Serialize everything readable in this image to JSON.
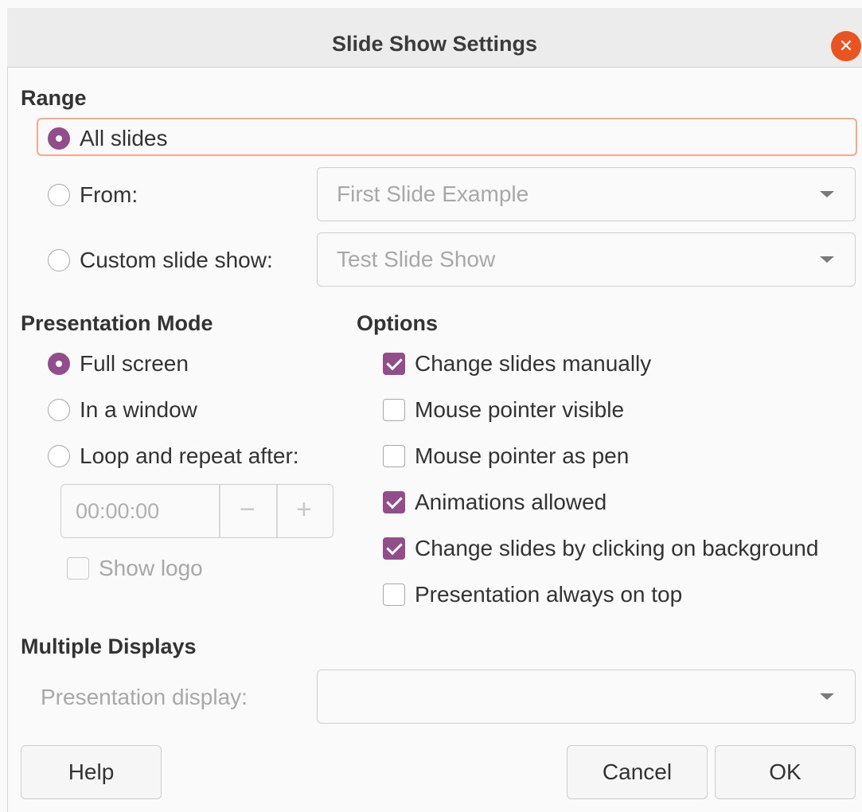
{
  "window": {
    "title": "Slide Show Settings"
  },
  "range": {
    "heading": "Range",
    "all_slides": "All slides",
    "from": "From:",
    "from_value": "First Slide Example",
    "custom": "Custom slide show:",
    "custom_value": "Test Slide Show"
  },
  "presentation_mode": {
    "heading": "Presentation Mode",
    "full_screen": "Full screen",
    "in_window": "In a window",
    "loop": "Loop and repeat after:",
    "loop_time": "00:00:00",
    "minus": "−",
    "plus": "+",
    "show_logo": "Show logo"
  },
  "options": {
    "heading": "Options",
    "items": [
      {
        "label": "Change slides manually",
        "checked": true
      },
      {
        "label": "Mouse pointer visible",
        "checked": false
      },
      {
        "label": "Mouse pointer as pen",
        "checked": false
      },
      {
        "label": "Animations allowed",
        "checked": true
      },
      {
        "label": "Change slides by clicking on background",
        "checked": true
      },
      {
        "label": "Presentation always on top",
        "checked": false
      }
    ]
  },
  "multiple_displays": {
    "heading": "Multiple Displays",
    "label": "Presentation display:",
    "value": ""
  },
  "buttons": {
    "help": "Help",
    "cancel": "Cancel",
    "ok": "OK"
  },
  "colors": {
    "accent": "#924d8b",
    "close": "#e95420",
    "focus": "#f3a98a"
  }
}
